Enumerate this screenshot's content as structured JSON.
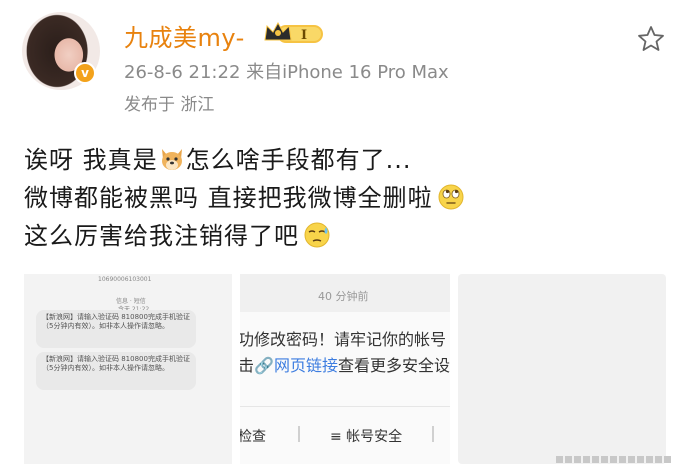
{
  "header": {
    "username": "九成美my-",
    "vip_label": "I",
    "verified_mark": "v",
    "meta": "26-8-6 21:22 来自iPhone 16 Pro Max",
    "location": "发布于 浙江"
  },
  "post": {
    "line1_a": "诶呀 我真是",
    "line1_b": "怎么啥手段都有了...",
    "line2": "微博都能被黑吗 直接把我微博全删啦",
    "line3": "这么厉害给我注销得了吧"
  },
  "image1": {
    "sender": "10690006103001",
    "subtitle": "信息 · 短信",
    "time": "今天 21:22",
    "sms1": "【新浪网】请输入验证码 810800完成手机验证（5分钟内有效）。如非本人操作请忽略。",
    "sms2": "【新浪网】请输入验证码 810800完成手机验证（5分钟内有效）。如非本人操作请忽略。"
  },
  "image2": {
    "time": "40 分钟前",
    "line1": "功修改密码！请牢记你的帐号",
    "line2_a": "击",
    "line2_link": "🔗网页链接",
    "line2_b": "查看更多安全设",
    "footer_left": "检查",
    "footer_mid": "≡ 帐号安全"
  },
  "icons": {
    "star": "star-outline-icon",
    "dog_emoji": "dog-face-emoji",
    "eyeroll_emoji": "eye-roll-emoji",
    "sweat_emoji": "sweat-emoji"
  },
  "colors": {
    "username": "#e8820e",
    "meta": "#8a8a8a",
    "link": "#3d7de0"
  }
}
